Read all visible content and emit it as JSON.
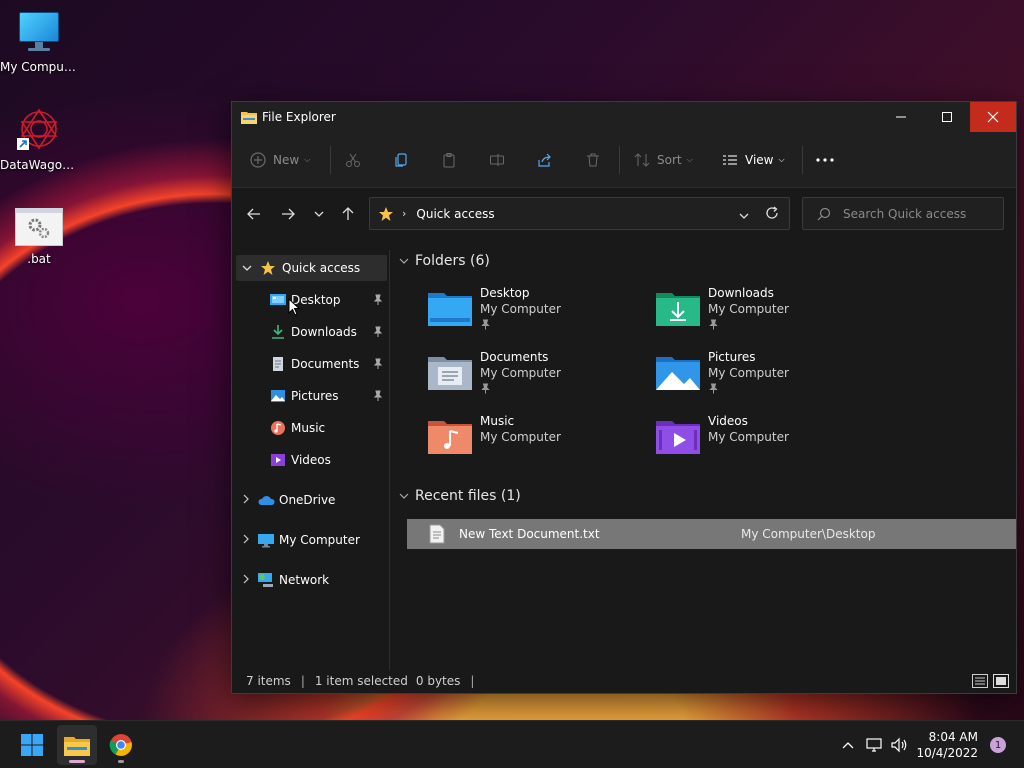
{
  "desktop": {
    "icons": [
      {
        "label": "My Computer"
      },
      {
        "label": "DataWagon..."
      },
      {
        "label": ".bat"
      }
    ]
  },
  "window": {
    "title": "File Explorer",
    "toolbar": {
      "new_label": "New",
      "sort_label": "Sort",
      "view_label": "View"
    },
    "address": {
      "path_label": "Quick access"
    },
    "search": {
      "placeholder": "Search Quick access"
    },
    "sidebar": {
      "quick_access": "Quick access",
      "items": [
        {
          "label": "Desktop",
          "pinned": true
        },
        {
          "label": "Downloads",
          "pinned": true
        },
        {
          "label": "Documents",
          "pinned": true
        },
        {
          "label": "Pictures",
          "pinned": true
        },
        {
          "label": "Music",
          "pinned": false
        },
        {
          "label": "Videos",
          "pinned": false
        }
      ],
      "roots": [
        {
          "label": "OneDrive"
        },
        {
          "label": "My Computer"
        },
        {
          "label": "Network"
        }
      ]
    },
    "folders_heading": "Folders (6)",
    "folders": [
      {
        "name": "Desktop",
        "location": "My Computer",
        "pinned": true
      },
      {
        "name": "Downloads",
        "location": "My Computer",
        "pinned": true
      },
      {
        "name": "Documents",
        "location": "My Computer",
        "pinned": true
      },
      {
        "name": "Pictures",
        "location": "My Computer",
        "pinned": true
      },
      {
        "name": "Music",
        "location": "My Computer",
        "pinned": false
      },
      {
        "name": "Videos",
        "location": "My Computer",
        "pinned": false
      }
    ],
    "recent_heading": "Recent files (1)",
    "recent_files": [
      {
        "name": "New Text Document.txt",
        "path": "My Computer\\Desktop"
      }
    ],
    "status": {
      "item_count": "7 items",
      "selection": "1 item selected",
      "size": "0 bytes"
    }
  },
  "taskbar": {
    "time": "8:04 AM",
    "date": "10/4/2022",
    "notifications": "1"
  },
  "colors": {
    "accent": "#c42b1c",
    "selected_row": "#777777",
    "folder_blue": "#3aa0e8"
  }
}
